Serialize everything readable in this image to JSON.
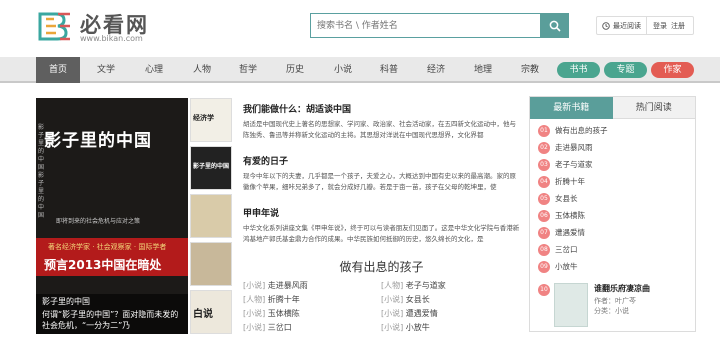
{
  "header": {
    "site_name": "必看网",
    "site_url": "www.bikan.com",
    "search_placeholder": "搜索书名 \\ 作者姓名",
    "recent_label": "最近阅读",
    "login": "登录",
    "register": "注册"
  },
  "nav": {
    "items": [
      "首页",
      "文学",
      "心理",
      "人物",
      "哲学",
      "历史",
      "小说",
      "科普",
      "经济",
      "地理",
      "宗教"
    ],
    "pills": [
      {
        "label": "书书",
        "color": "#4aa58f"
      },
      {
        "label": "专题",
        "color": "#4aa58f"
      },
      {
        "label": "作家",
        "color": "#e35c53"
      }
    ]
  },
  "slider": {
    "cover_title": "影子里的中国",
    "cover_vertical": "影子里的中国影子里的中国",
    "cover_sub": "即将到来的社会危机与应对之策",
    "cover_red_line1": "著名经济学家 · 社会观察家 · 国际学者",
    "cover_red_line2": "预言2013中国在暗处",
    "caption_title": "影子里的中国",
    "caption_desc": "何谓“影子里的中国”？面对隐而未发的社会危机，“一分为二”乃"
  },
  "thumbs": [
    "经济学",
    "影子里的中国",
    "",
    "白说"
  ],
  "articles": [
    {
      "title": "我们能做什么：胡适谈中国",
      "body": "胡适是中国现代史上著名的思想家、学问家、政治家、社会活动家，在五四新文化运动中，他与陈独秀、鲁迅等并称新文化运动的主将。其思想对洋说在中国现代思想界，文化界都"
    },
    {
      "title": "有爱的日子",
      "body": "现今中年以下的夫妻，几乎都是一个孩子，夫爱之心，大概达到中国有史以来的最高潮。家的原徽像个苹果，细咔兄弟多了，就会分成好几瓣。若是于亩一苗，孩子在父母的乾坤里，使"
    },
    {
      "title": "甲申年说",
      "body": "中华文化系列讲座文集《甲申年说》，终于可以与读者朋友们见面了。这是中华文化学院与香港新鸿基地产郭氏基金鼎力合作的成果。中华民族如何抵御的历史，悠久绵长的文化，是"
    }
  ],
  "interesting": {
    "title": "做有出息的孩子",
    "items": [
      {
        "cat": "[小说]",
        "name": "走进暴风雨"
      },
      {
        "cat": "[人物]",
        "name": "老子与道家"
      },
      {
        "cat": "[人物]",
        "name": "折腾十年"
      },
      {
        "cat": "[小说]",
        "name": "女县长"
      },
      {
        "cat": "[小说]",
        "name": "玉体横陈"
      },
      {
        "cat": "[小说]",
        "name": "遭遇爱情"
      },
      {
        "cat": "[小说]",
        "name": "三岔口"
      },
      {
        "cat": "[小说]",
        "name": "小放牛"
      }
    ]
  },
  "rank": {
    "tab_new": "最新书籍",
    "tab_hot": "热门阅读",
    "items": [
      {
        "num": "01",
        "name": "做有出息的孩子"
      },
      {
        "num": "02",
        "name": "走进暴风雨"
      },
      {
        "num": "03",
        "name": "老子与道家"
      },
      {
        "num": "04",
        "name": "折腾十年"
      },
      {
        "num": "05",
        "name": "女县长"
      },
      {
        "num": "06",
        "name": "玉体横陈"
      },
      {
        "num": "07",
        "name": "遭遇爱情"
      },
      {
        "num": "08",
        "name": "三岔口"
      },
      {
        "num": "09",
        "name": "小放牛"
      }
    ],
    "feature": {
      "num": "10",
      "title": "谁翻乐府凄凉曲",
      "author": "作者：叶广芩",
      "category": "分类：小说"
    }
  }
}
